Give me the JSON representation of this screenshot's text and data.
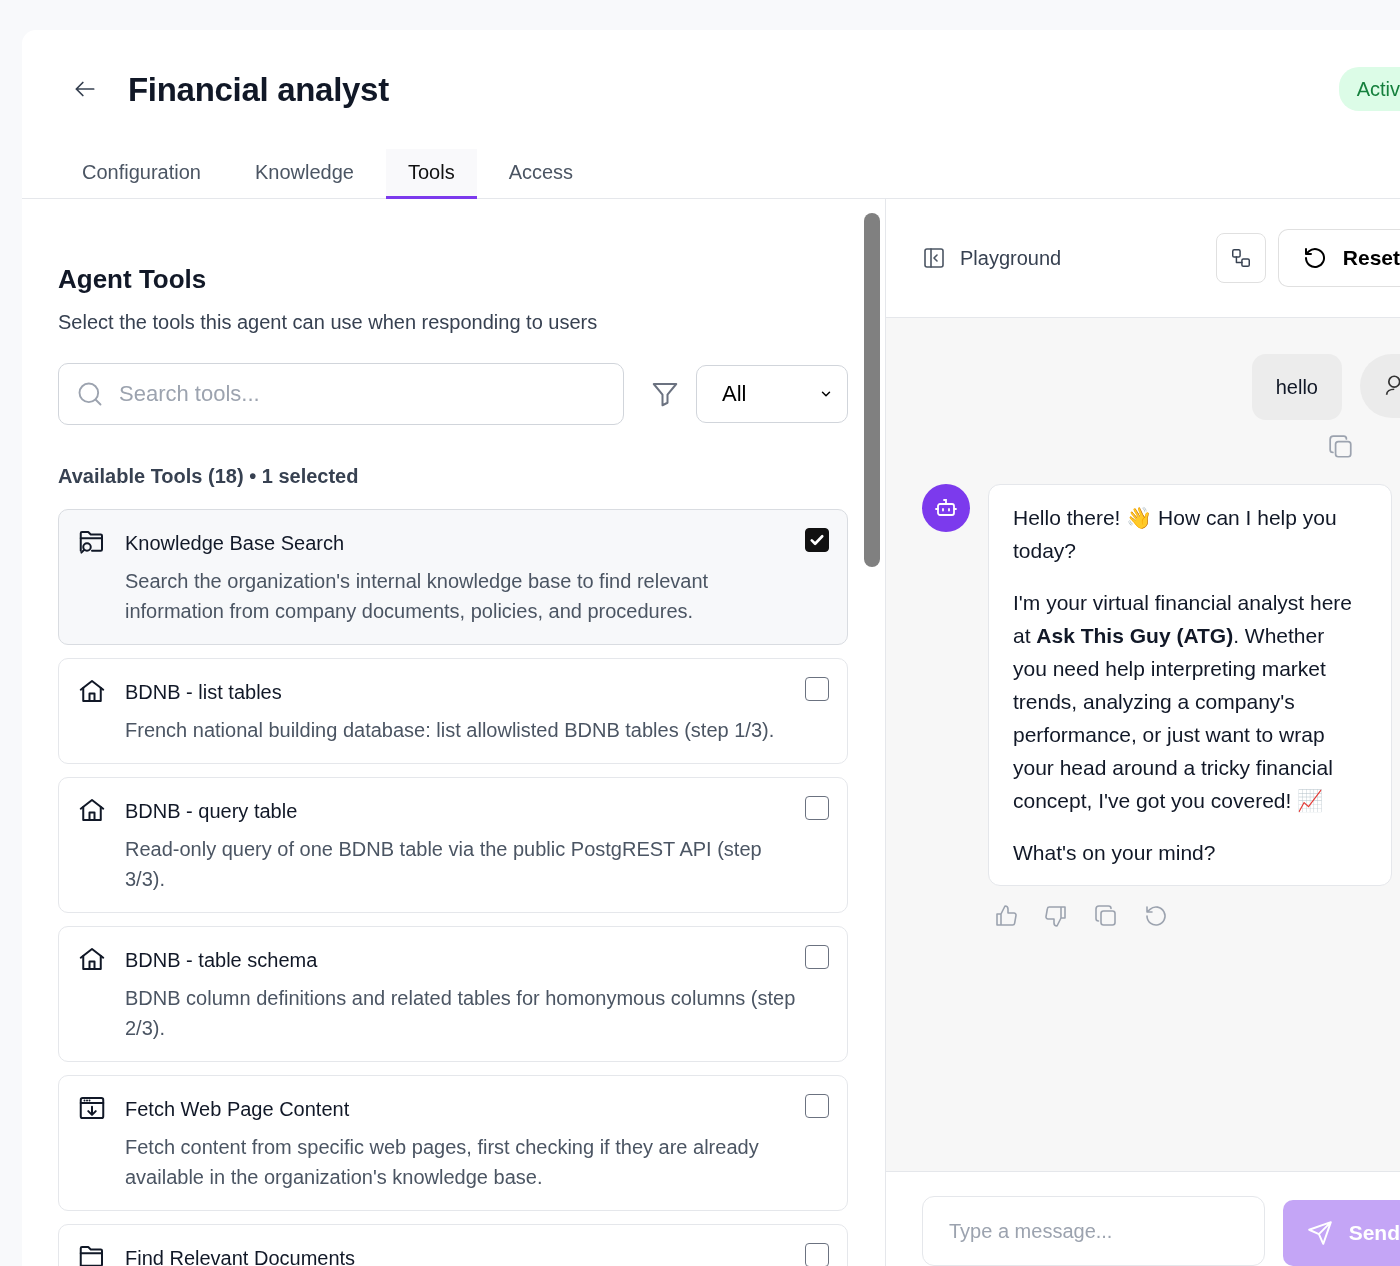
{
  "page": {
    "title": "Financial analyst",
    "status_badge": "Activ"
  },
  "tabs": [
    {
      "label": "Configuration",
      "selected": false
    },
    {
      "label": "Knowledge",
      "selected": false
    },
    {
      "label": "Tools",
      "selected": true
    },
    {
      "label": "Access",
      "selected": false
    }
  ],
  "tools_panel": {
    "heading": "Agent Tools",
    "subtitle": "Select the tools this agent can use when responding to users",
    "search": {
      "placeholder": "Search tools..."
    },
    "filter": {
      "value": "All"
    },
    "summary": "Available Tools (18) • 1 selected",
    "tools": [
      {
        "kind": "folder-search",
        "title": "Knowledge Base Search",
        "description": "Search the organization's internal knowledge base to find relevant information from company documents, policies, and procedures.",
        "checked": true
      },
      {
        "kind": "house",
        "title": "BDNB - list tables",
        "description": "French national building database: list allowlisted BDNB tables (step 1/3).",
        "checked": false
      },
      {
        "kind": "house",
        "title": "BDNB - query table",
        "description": "Read-only query of one BDNB table via the public PostgREST API (step 3/3).",
        "checked": false
      },
      {
        "kind": "house",
        "title": "BDNB - table schema",
        "description": "BDNB column definitions and related tables for homonymous columns (step 2/3).",
        "checked": false
      },
      {
        "kind": "web-download",
        "title": "Fetch Web Page Content",
        "description": "Fetch content from specific web pages, first checking if they are already available in the organization's knowledge base.",
        "checked": false
      },
      {
        "kind": "folder",
        "title": "Find Relevant Documents",
        "checked": false
      }
    ]
  },
  "playground": {
    "title": "Playground",
    "reset_button": "Reset",
    "messages": [
      {
        "kind": "user",
        "paragraphs": [
          "hello"
        ]
      },
      {
        "kind": "assistant",
        "paragraphs": [
          "Hello there! 👋 How can I help you today?",
          "I'm your virtual financial analyst here at **Ask This Guy (ATG)**. Whether you need help interpreting market trends, analyzing a company's performance, or just want to wrap your head around a tricky financial concept, I've got you covered! 📈",
          "What's on your mind?"
        ]
      }
    ],
    "input": {
      "placeholder": "Type a message..."
    },
    "send_button": {
      "label": "Send",
      "disabled": true
    }
  }
}
